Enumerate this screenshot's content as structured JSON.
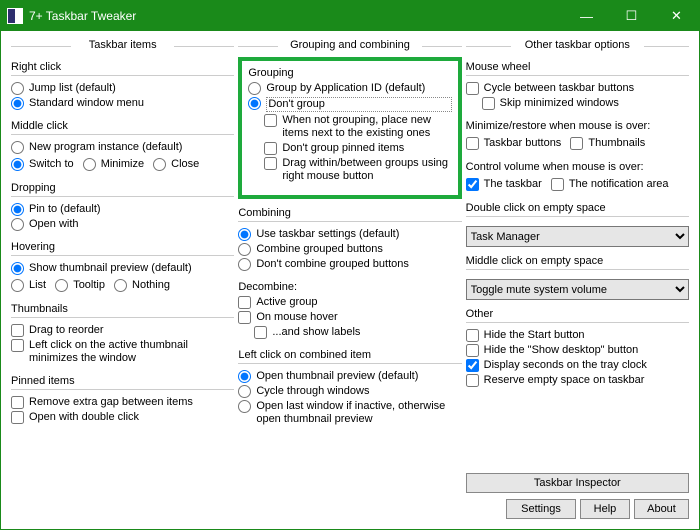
{
  "window": {
    "title": "7+ Taskbar Tweaker"
  },
  "columns": {
    "c1": "Taskbar items",
    "c2": "Grouping and combining",
    "c3": "Other taskbar options"
  },
  "col1": {
    "rightclick": {
      "title": "Right click",
      "jump": "Jump list (default)",
      "std": "Standard window menu"
    },
    "middleclick": {
      "title": "Middle click",
      "newprog": "New program instance (default)",
      "switch": "Switch to",
      "min": "Minimize",
      "close": "Close"
    },
    "dropping": {
      "title": "Dropping",
      "pin": "Pin to (default)",
      "open": "Open with"
    },
    "hovering": {
      "title": "Hovering",
      "thumb": "Show thumbnail preview (default)",
      "list": "List",
      "tooltip": "Tooltip",
      "nothing": "Nothing"
    },
    "thumbnails": {
      "title": "Thumbnails",
      "drag": "Drag to reorder",
      "leftclick": "Left click on the active thumbnail minimizes the window"
    },
    "pinned": {
      "title": "Pinned items",
      "gap": "Remove extra gap between items",
      "dbl": "Open with double click"
    }
  },
  "col2": {
    "grouping": {
      "title": "Grouping",
      "byid": "Group by Application ID (default)",
      "dont": "Don't group",
      "place": "When not grouping, place new items next to the existing ones",
      "dontpinned": "Don't group pinned items",
      "drag": "Drag within/between groups using right mouse button"
    },
    "combining": {
      "title": "Combining",
      "use": "Use taskbar settings (default)",
      "combine": "Combine grouped buttons",
      "dont": "Don't combine grouped buttons"
    },
    "decombine": {
      "title": "Decombine:",
      "active": "Active group",
      "hover": "On mouse hover",
      "labels": "...and show labels"
    },
    "leftclick": {
      "title": "Left click on combined item",
      "thumb": "Open thumbnail preview (default)",
      "cycle": "Cycle through windows",
      "last": "Open last window if inactive, otherwise open thumbnail preview"
    }
  },
  "col3": {
    "wheel": {
      "title": "Mouse wheel",
      "cycle": "Cycle between taskbar buttons",
      "skip": "Skip minimized windows"
    },
    "minrestore": {
      "title": "Minimize/restore when mouse is over:",
      "tb": "Taskbar buttons",
      "th": "Thumbnails"
    },
    "volume": {
      "title": "Control volume when mouse is over:",
      "tb": "The taskbar",
      "na": "The notification area"
    },
    "dblclick": {
      "title": "Double click on empty space",
      "sel": "Task Manager"
    },
    "midclick": {
      "title": "Middle click on empty space",
      "sel": "Toggle mute system volume"
    },
    "other": {
      "title": "Other",
      "start": "Hide the Start button",
      "showdesk": "Hide the \"Show desktop\" button",
      "seconds": "Display seconds on the tray clock",
      "reserve": "Reserve empty space on taskbar"
    },
    "buttons": {
      "inspector": "Taskbar Inspector",
      "settings": "Settings",
      "help": "Help",
      "about": "About"
    }
  }
}
